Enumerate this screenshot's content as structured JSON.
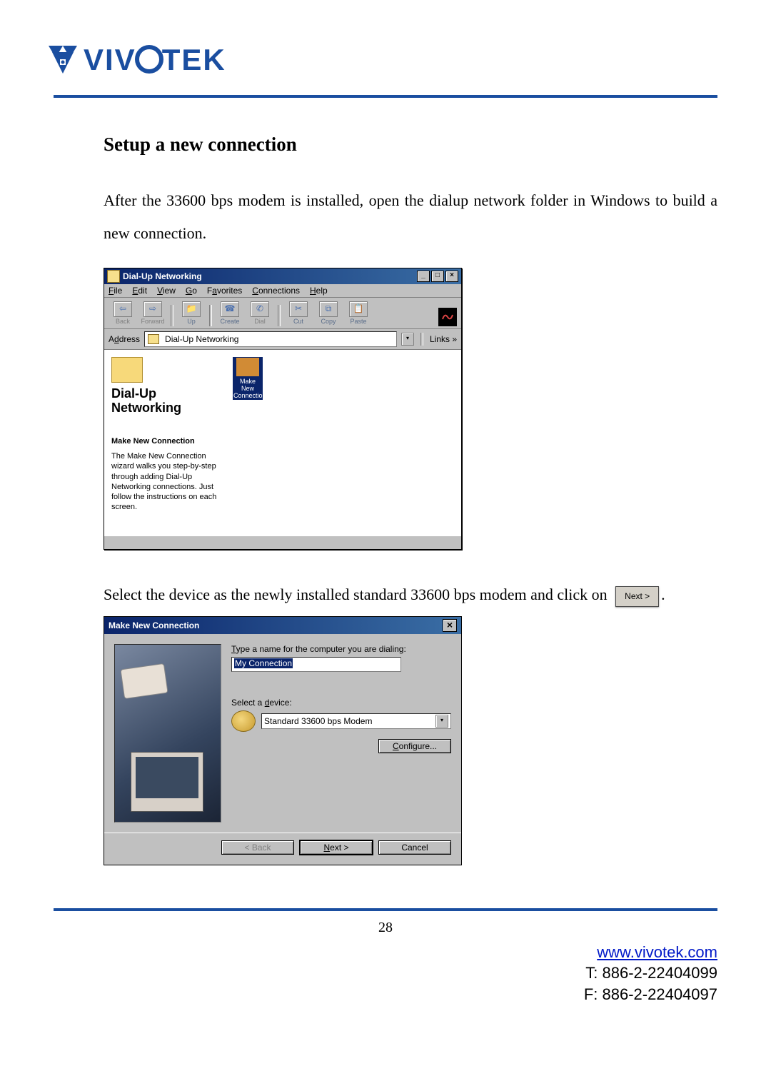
{
  "logo": {
    "text": "VIVOTEK"
  },
  "section_title": "Setup a new connection",
  "para1": "After the 33600 bps modem is installed, open the dialup network folder in Windows to build a new connection.",
  "para2_a": "Select the device as the newly installed standard 33600 bps modem and click on",
  "para2_next": "Next >",
  "para2_b": ".",
  "win1": {
    "title": "Dial-Up Networking",
    "menu": {
      "file": "File",
      "edit": "Edit",
      "view": "View",
      "go": "Go",
      "favorites": "Favorites",
      "connections": "Connections",
      "help": "Help"
    },
    "tools": {
      "back": "Back",
      "forward": "Forward",
      "up": "Up",
      "create": "Create",
      "dial": "Dial",
      "cut": "Cut",
      "copy": "Copy",
      "paste": "Paste"
    },
    "address_label": "Address",
    "address_value": "Dial-Up Networking",
    "links_label": "Links »",
    "panel_title": "Dial-Up Networking",
    "item_name": "Make New Connection",
    "item_desc": "The Make New Connection wizard walks you step-by-step through adding Dial-Up Networking connections. Just follow the instructions on each screen.",
    "sel_icon_label": "Make New Connection"
  },
  "win2": {
    "title": "Make New Connection",
    "label_name": "Type a name for the computer you are dialing:",
    "name_value": "My Connection",
    "label_device": "Select a device:",
    "device_value": "Standard 33600 bps Modem",
    "btn_configure": "Configure...",
    "btn_back": "< Back",
    "btn_next": "Next >",
    "btn_cancel": "Cancel"
  },
  "page_number": "28",
  "footer": {
    "url": "www.vivotek.com",
    "tel": "T: 886-2-22404099",
    "fax": "F: 886-2-22404097"
  }
}
